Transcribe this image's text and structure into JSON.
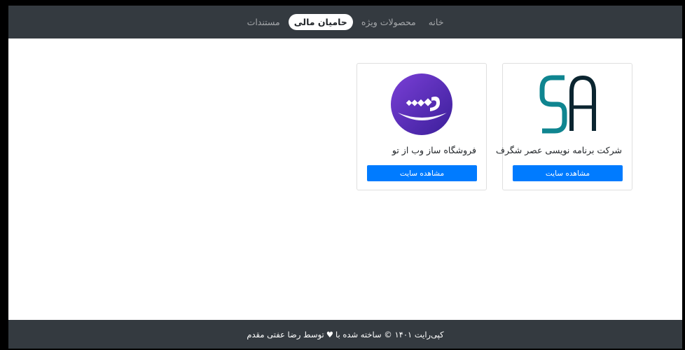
{
  "nav": {
    "items": [
      {
        "label": "خانه",
        "active": false
      },
      {
        "label": "محصولات ویژه",
        "active": false
      },
      {
        "label": "حامیان مالی",
        "active": true
      },
      {
        "label": "مستندات",
        "active": false
      }
    ]
  },
  "sponsors": [
    {
      "title": "فروشگاه ساز وب از تو",
      "button": "مشاهده سایت",
      "logo": "vazto-logo"
    },
    {
      "title": "شرکت برنامه نویسی عصر شگرف",
      "button": "مشاهده سایت",
      "logo": "sa-logo"
    }
  ],
  "footer": {
    "text_before": "کپی‌رایت ۱۴۰۱ © ساخته شده با",
    "heart": "♥",
    "text_after": "توسط رضا عفتی مقدم"
  },
  "colors": {
    "navbar": "#343a40",
    "primary": "#007bff",
    "vazto_purple": "#5b2dbf",
    "sa_teal": "#0f8590"
  }
}
